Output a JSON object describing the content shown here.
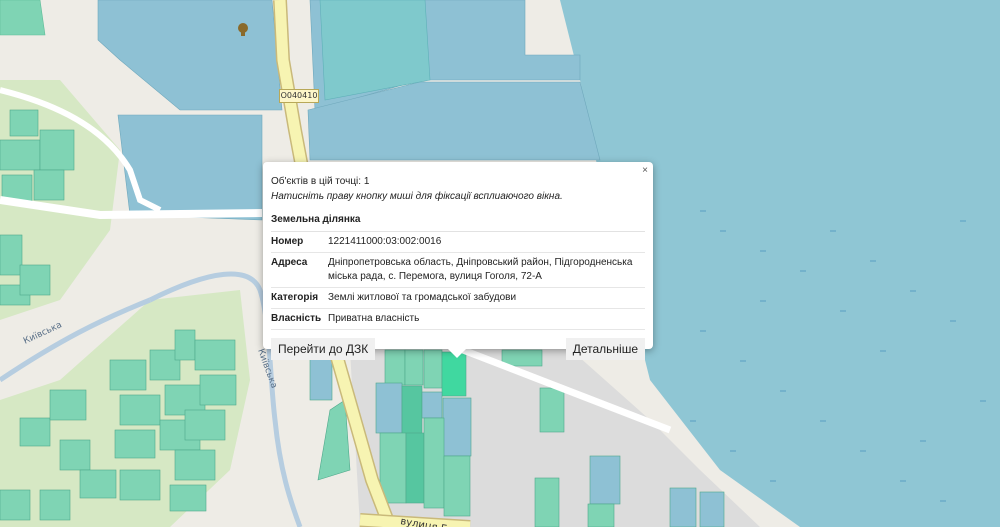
{
  "map": {
    "road_ref": "O040410",
    "street_left": "Київська",
    "street_mid": "Київська",
    "street_bottom": "вулиця Гоголя"
  },
  "popup": {
    "close_label": "×",
    "object_count": "Об'єктів в цій точці: 1",
    "hint": "Натисніть праву кнопку миші для фіксації всплиаючого вікна.",
    "section_title": "Земельна ділянка",
    "rows": [
      {
        "key": "Номер",
        "value": "1221411000:03:002:0016"
      },
      {
        "key": "Адреса",
        "value": "Дніпропетровська область, Дніпровський район, Підгородненська міська рада, с. Перемога, вулиця Гоголя, 72-А"
      },
      {
        "key": "Категорія",
        "value": "Землі житлової та громадської забудови"
      },
      {
        "key": "Власність",
        "value": "Приватна власність"
      }
    ],
    "btn_dzk": "Перейти до ДЗК",
    "btn_details": "Детальніше"
  },
  "colors": {
    "water": "#8fc6d4",
    "parcel_blue": "#8ec1d4",
    "parcel_green": "#7fd4b4",
    "parcel_bright": "#40d8a0",
    "road": "#f7f4b2"
  }
}
